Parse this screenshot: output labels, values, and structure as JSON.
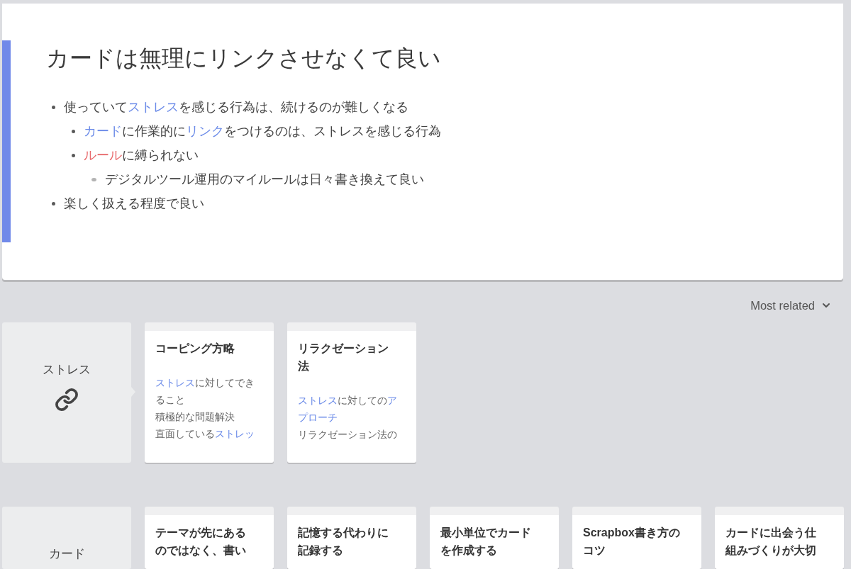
{
  "page": {
    "title": "カードは無理にリンクさせなくて良い",
    "bullets": [
      {
        "segments": [
          {
            "kind": "text",
            "text": "使っていて"
          },
          {
            "kind": "link",
            "text": "ストレス"
          },
          {
            "kind": "text",
            "text": "を感じる行為は、続けるのが難しくなる"
          }
        ],
        "children": [
          {
            "segments": [
              {
                "kind": "link",
                "text": "カード"
              },
              {
                "kind": "text",
                "text": "に作業的に"
              },
              {
                "kind": "link",
                "text": "リンク"
              },
              {
                "kind": "text",
                "text": "をつけるのは、ストレスを感じる行為"
              }
            ]
          },
          {
            "segments": [
              {
                "kind": "empty_link",
                "text": "ルール"
              },
              {
                "kind": "text",
                "text": "に縛られない"
              }
            ],
            "children": [
              {
                "segments": [
                  {
                    "kind": "text",
                    "text": "デジタルツール運用のマイルールは日々書き換えて良い"
                  }
                ]
              }
            ]
          }
        ]
      },
      {
        "segments": [
          {
            "kind": "text",
            "text": "楽しく扱える程度で良い"
          }
        ]
      }
    ]
  },
  "sort": {
    "label": "Most related"
  },
  "groups": [
    {
      "name": "ストレス",
      "cards": [
        {
          "title": "コーピング方略",
          "summary": [
            [
              {
                "kind": "link",
                "text": "ストレス"
              },
              {
                "kind": "text",
                "text": "に対してでき"
              }
            ],
            [
              {
                "kind": "text",
                "text": "ること"
              }
            ],
            [
              {
                "kind": "text",
                "text": "積極的な問題解決"
              }
            ],
            [
              {
                "kind": "text",
                "text": "直面している"
              },
              {
                "kind": "link",
                "text": "ストレッ"
              }
            ]
          ]
        },
        {
          "title": "リラクゼーション法",
          "summary": [
            [
              {
                "kind": "link",
                "text": "ストレス"
              },
              {
                "kind": "text",
                "text": "に対しての"
              },
              {
                "kind": "link",
                "text": "ア"
              }
            ],
            [
              {
                "kind": "link",
                "text": "プローチ"
              }
            ],
            [
              {
                "kind": "text",
                "text": "リラクゼーション法の"
              }
            ]
          ]
        }
      ]
    },
    {
      "name": "カード",
      "cards": [
        {
          "title": "テーマが先にあるのではなく、書い"
        },
        {
          "title": "記憶する代わりに記録する"
        },
        {
          "title": "最小単位でカードを作成する"
        },
        {
          "title": "Scrapbox書き方のコツ"
        },
        {
          "title": "カードに出会う仕組みづくりが大切"
        }
      ]
    }
  ]
}
